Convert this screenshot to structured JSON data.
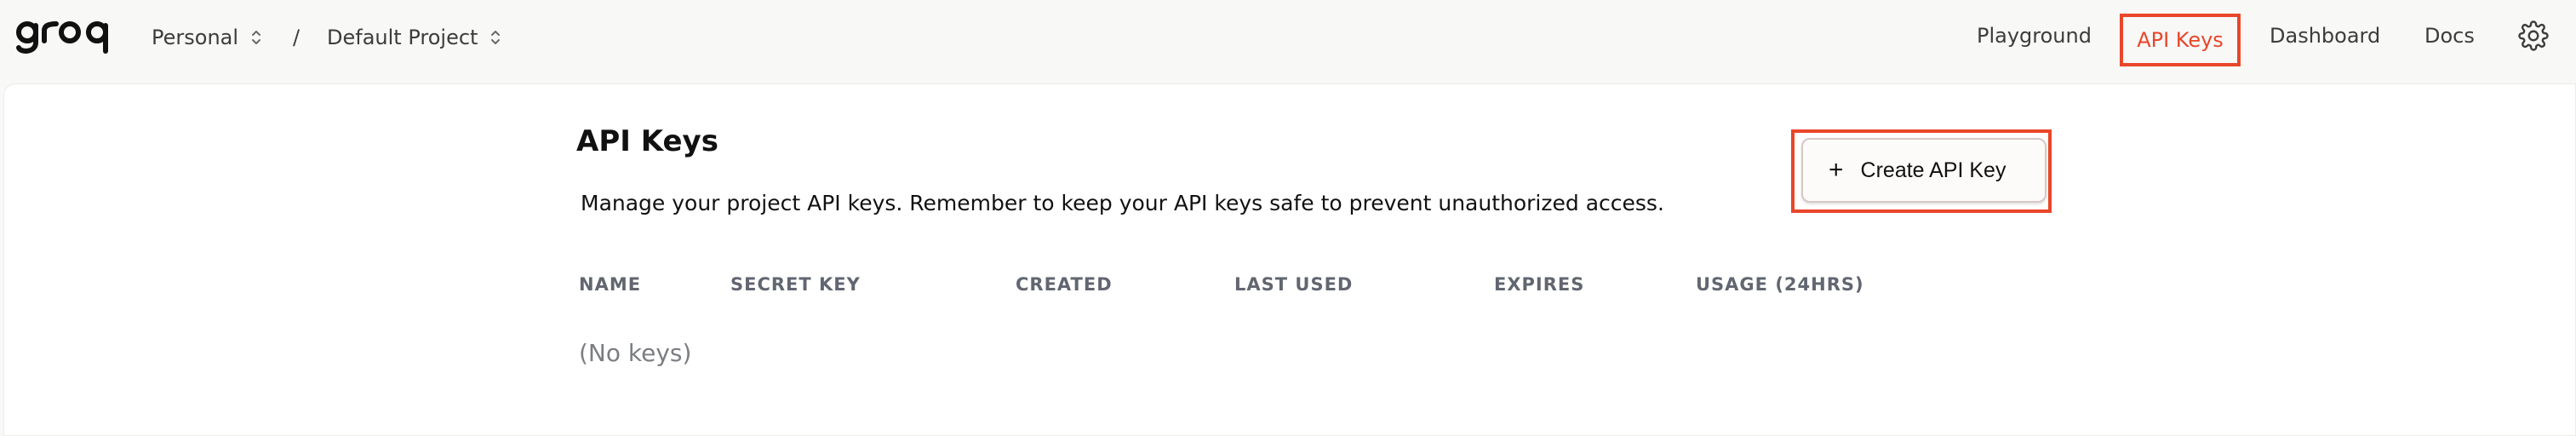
{
  "header": {
    "logo_text": "groq",
    "org_selector": "Personal",
    "separator": "/",
    "project_selector": "Default Project"
  },
  "nav": {
    "playground": "Playground",
    "api_keys": "API Keys",
    "dashboard": "Dashboard",
    "docs": "Docs",
    "settings_icon": "gear-icon"
  },
  "page": {
    "title": "API Keys",
    "description": "Manage your project API keys. Remember to keep your API keys safe to prevent unauthorized access.",
    "create_button_label": "Create API Key",
    "create_button_icon": "+"
  },
  "table": {
    "columns": [
      "NAME",
      "SECRET KEY",
      "CREATED",
      "LAST USED",
      "EXPIRES",
      "USAGE (24HRS)"
    ],
    "empty_text": "(No keys)"
  },
  "colors": {
    "highlight": "#e9462a",
    "nav_text": "#3c3c3c",
    "column_header": "#616670"
  }
}
